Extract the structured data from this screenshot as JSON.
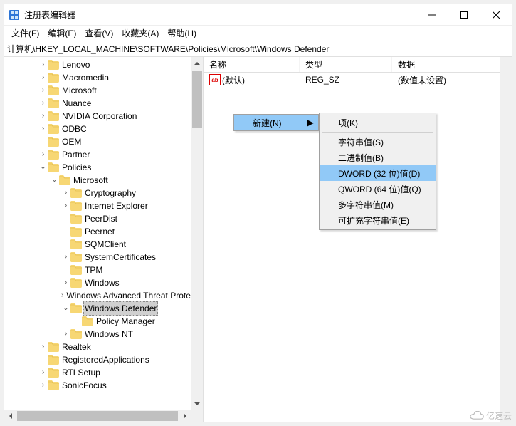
{
  "window": {
    "title": "注册表编辑器"
  },
  "menu": {
    "file": "文件(F)",
    "edit": "编辑(E)",
    "view": "查看(V)",
    "fav": "收藏夹(A)",
    "help": "帮助(H)"
  },
  "address": "计算机\\HKEY_LOCAL_MACHINE\\SOFTWARE\\Policies\\Microsoft\\Windows Defender",
  "tree": {
    "items": [
      {
        "d": 3,
        "exp": ">",
        "l": "Lenovo"
      },
      {
        "d": 3,
        "exp": ">",
        "l": "Macromedia"
      },
      {
        "d": 3,
        "exp": ">",
        "l": "Microsoft"
      },
      {
        "d": 3,
        "exp": ">",
        "l": "Nuance"
      },
      {
        "d": 3,
        "exp": ">",
        "l": "NVIDIA Corporation"
      },
      {
        "d": 3,
        "exp": ">",
        "l": "ODBC"
      },
      {
        "d": 3,
        "exp": "",
        "l": "OEM"
      },
      {
        "d": 3,
        "exp": ">",
        "l": "Partner"
      },
      {
        "d": 3,
        "exp": "v",
        "l": "Policies"
      },
      {
        "d": 4,
        "exp": "v",
        "l": "Microsoft"
      },
      {
        "d": 5,
        "exp": ">",
        "l": "Cryptography"
      },
      {
        "d": 5,
        "exp": ">",
        "l": "Internet Explorer"
      },
      {
        "d": 5,
        "exp": "",
        "l": "PeerDist"
      },
      {
        "d": 5,
        "exp": "",
        "l": "Peernet"
      },
      {
        "d": 5,
        "exp": "",
        "l": "SQMClient"
      },
      {
        "d": 5,
        "exp": ">",
        "l": "SystemCertificates"
      },
      {
        "d": 5,
        "exp": "",
        "l": "TPM"
      },
      {
        "d": 5,
        "exp": ">",
        "l": "Windows"
      },
      {
        "d": 5,
        "exp": ">",
        "l": "Windows Advanced Threat Protection"
      },
      {
        "d": 5,
        "exp": "v",
        "l": "Windows Defender",
        "sel": true
      },
      {
        "d": 6,
        "exp": "",
        "l": "Policy Manager"
      },
      {
        "d": 5,
        "exp": ">",
        "l": "Windows NT"
      },
      {
        "d": 3,
        "exp": ">",
        "l": "Realtek"
      },
      {
        "d": 3,
        "exp": "",
        "l": "RegisteredApplications"
      },
      {
        "d": 3,
        "exp": ">",
        "l": "RTLSetup"
      },
      {
        "d": 3,
        "exp": ">",
        "l": "SonicFocus"
      }
    ]
  },
  "listview": {
    "headers": {
      "name": "名称",
      "type": "类型",
      "data": "数据"
    },
    "rows": [
      {
        "name": "(默认)",
        "type": "REG_SZ",
        "data": "(数值未设置)"
      }
    ]
  },
  "context1": {
    "new": "新建(N)"
  },
  "context2": {
    "key": "项(K)",
    "string": "字符串值(S)",
    "binary": "二进制值(B)",
    "dword": "DWORD (32 位)值(D)",
    "qword": "QWORD (64 位)值(Q)",
    "multi": "多字符串值(M)",
    "expand": "可扩充字符串值(E)"
  },
  "watermark": "亿速云"
}
